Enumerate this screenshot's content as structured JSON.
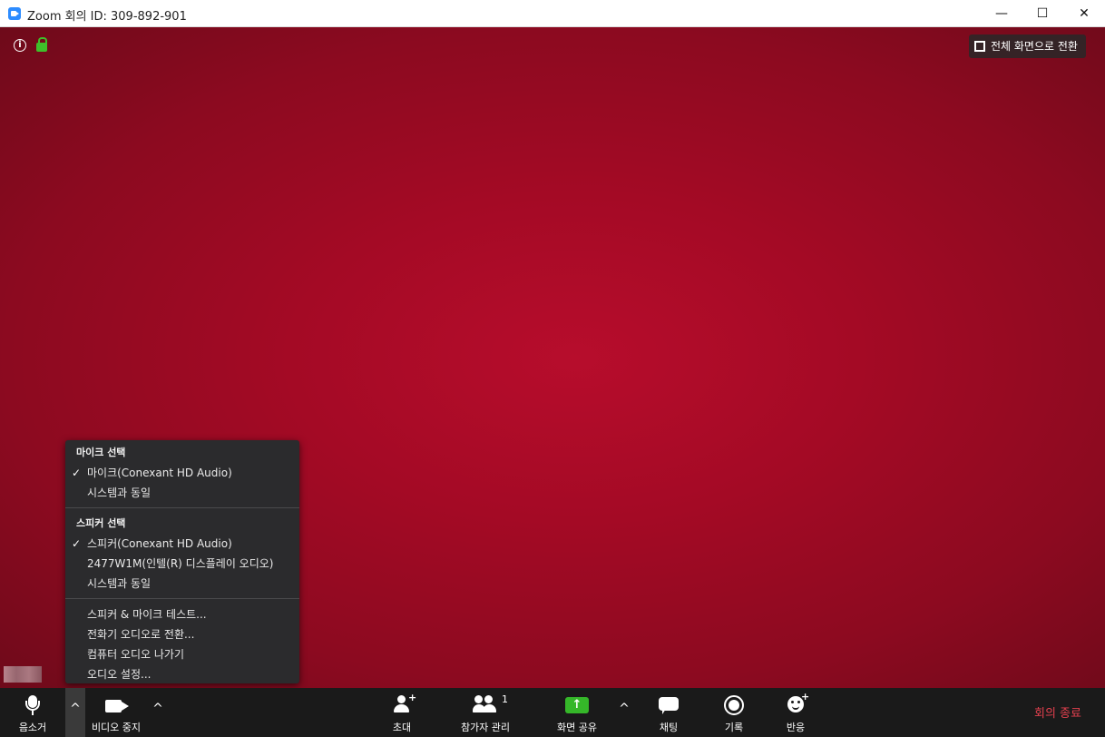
{
  "window": {
    "title": "Zoom 회의 ID: 309-892-901",
    "minimize": "—",
    "maximize": "☐",
    "close": "✕"
  },
  "video": {
    "fullscreen_label": "전체 화면으로 전환",
    "info_icon": "i"
  },
  "audio_menu": {
    "mic_header": "마이크 선택",
    "mic_items": [
      {
        "label": "마이크(Conexant HD Audio)",
        "checked": true
      },
      {
        "label": "시스템과 동일",
        "checked": false
      }
    ],
    "speaker_header": "스피커 선택",
    "speaker_items": [
      {
        "label": "스피커(Conexant HD Audio)",
        "checked": true
      },
      {
        "label": "2477W1M(인텔(R) 디스플레이 오디오)",
        "checked": false
      },
      {
        "label": "시스템과 동일",
        "checked": false
      }
    ],
    "actions": [
      "스피커 & 마이크 테스트...",
      "전화기 오디오로 전환...",
      "컴퓨터 오디오 나가기",
      "오디오 설정..."
    ],
    "check_mark": "✓"
  },
  "toolbar": {
    "mute": "음소거",
    "video_stop": "비디오 중지",
    "invite": "초대",
    "participants": "참가자 관리",
    "participant_count": "1",
    "share": "화면 공유",
    "share_arrow": "↑",
    "chat": "채팅",
    "record": "기록",
    "reactions": "반응",
    "end": "회의 종료",
    "caret": "^",
    "plus": "+"
  },
  "colors": {
    "video_bg": "#a40a25",
    "share_green": "#35b729",
    "end_red": "#e2404e",
    "lock_green": "#3fbf2a"
  }
}
